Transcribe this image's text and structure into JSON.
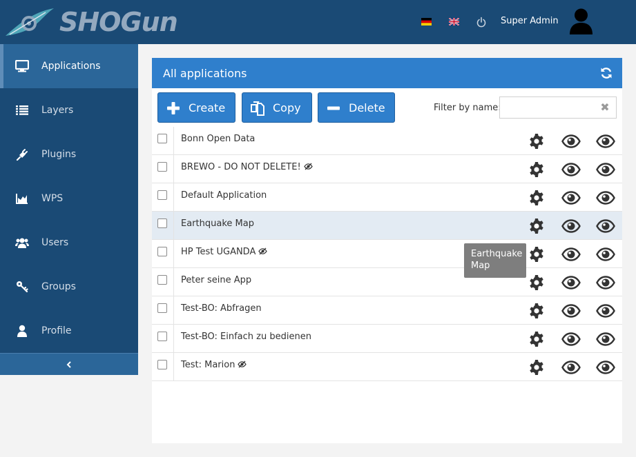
{
  "header": {
    "logo_text": "SHOGun",
    "flag_de": "german-flag-icon",
    "flag_en": "uk-flag-icon",
    "logout_icon": "power-icon",
    "user_name": "Super Admin",
    "avatar_icon": "user-icon"
  },
  "sidebar": {
    "items": [
      {
        "label": "Applications",
        "icon": "monitor-icon"
      },
      {
        "label": "Layers",
        "icon": "list-icon"
      },
      {
        "label": "Plugins",
        "icon": "plug-icon"
      },
      {
        "label": "WPS",
        "icon": "area-chart-icon"
      },
      {
        "label": "Users",
        "icon": "users-icon"
      },
      {
        "label": "Groups",
        "icon": "key-icon"
      },
      {
        "label": "Profile",
        "icon": "user-icon"
      }
    ],
    "collapse_icon": "chevron-left-icon"
  },
  "panel": {
    "title": "All applications",
    "refresh_icon": "refresh-icon"
  },
  "toolbar": {
    "create_label": "Create",
    "copy_label": "Copy",
    "delete_label": "Delete",
    "filter_label": "Filter by name:",
    "filter_value": ""
  },
  "applications": [
    {
      "name": "Bonn Open Data",
      "hidden": false
    },
    {
      "name": "BREWO - DO NOT DELETE!",
      "hidden": true
    },
    {
      "name": "Default Application",
      "hidden": false
    },
    {
      "name": "Earthquake Map",
      "hidden": false
    },
    {
      "name": "HP Test UGANDA",
      "hidden": true
    },
    {
      "name": "Peter seine App",
      "hidden": false
    },
    {
      "name": "Test-BO: Abfragen",
      "hidden": false
    },
    {
      "name": "Test-BO: Einfach zu bedienen",
      "hidden": false
    },
    {
      "name": "Test: Marion",
      "hidden": true
    }
  ],
  "tooltip": {
    "text_line1": "Earthquake",
    "text_line2": "Map"
  },
  "colors": {
    "header_bg": "#1a4a75",
    "accent": "#2f7fcc",
    "sidebar_active": "#2b6699"
  }
}
